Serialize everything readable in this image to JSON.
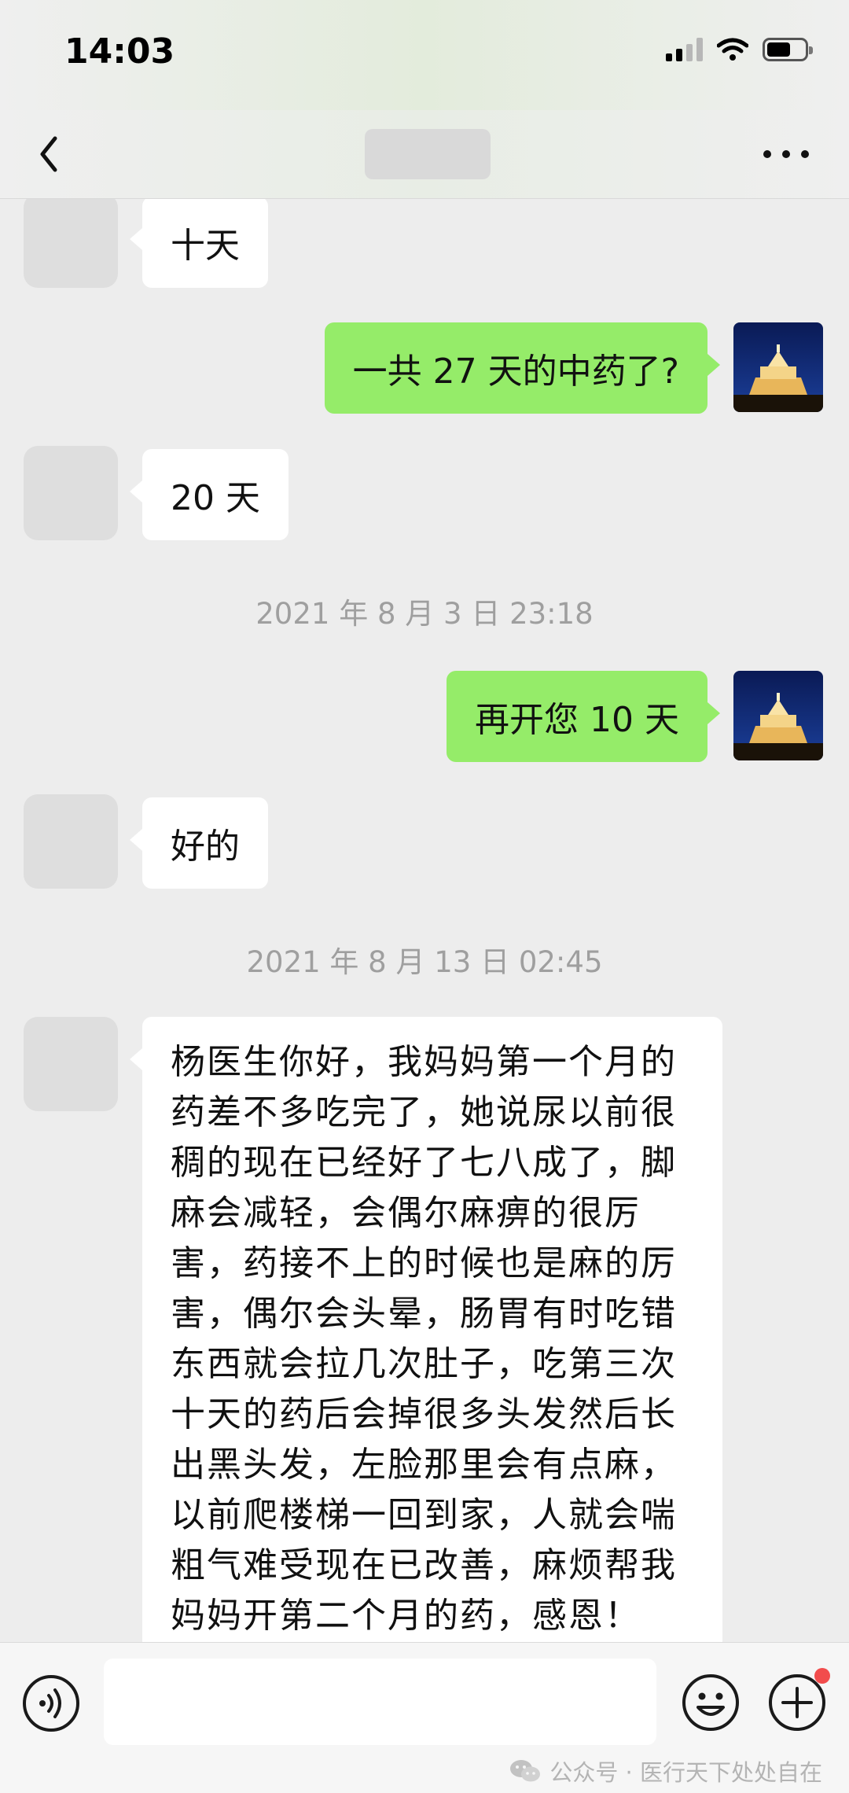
{
  "status_bar": {
    "time": "14:03"
  },
  "messages": {
    "m1": "十天",
    "m2": "一共 27 天的中药了?",
    "m3": "20 天",
    "ts1": "2021 年 8 月 3 日 23:18",
    "m4": "再开您 10 天",
    "m5": "好的",
    "ts2": "2021 年 8 月 13 日 02:45",
    "m6_lines": [
      "杨医生你好，我妈妈第一个月的",
      "药差不多吃完了，她说尿以前很",
      "稠的现在已经好了七八成了，脚",
      "麻会减轻，会偶尔麻痹的很厉",
      "害，药接不上的时候也是麻的厉",
      "害，偶尔会头晕，肠胃有时吃错",
      "东西就会拉几次肚子，吃第三次",
      "十天的药后会掉很多头发然后长",
      "出黑头发，左脸那里会有点麻，",
      "以前爬楼梯一回到家，人就会喘",
      "粗气难受现在已改善，麻烦帮我",
      "妈妈开第二个月的药，感恩！"
    ]
  },
  "watermark": "公众号 · 医行天下处处自在",
  "colors": {
    "outgoing_bubble": "#95ec69",
    "incoming_bubble": "#ffffff",
    "background": "#ededed",
    "badge": "#f24c4c"
  },
  "icons": [
    "back-icon",
    "more-icon",
    "voice-icon",
    "emoji-icon",
    "plus-icon",
    "wechat-icon"
  ]
}
